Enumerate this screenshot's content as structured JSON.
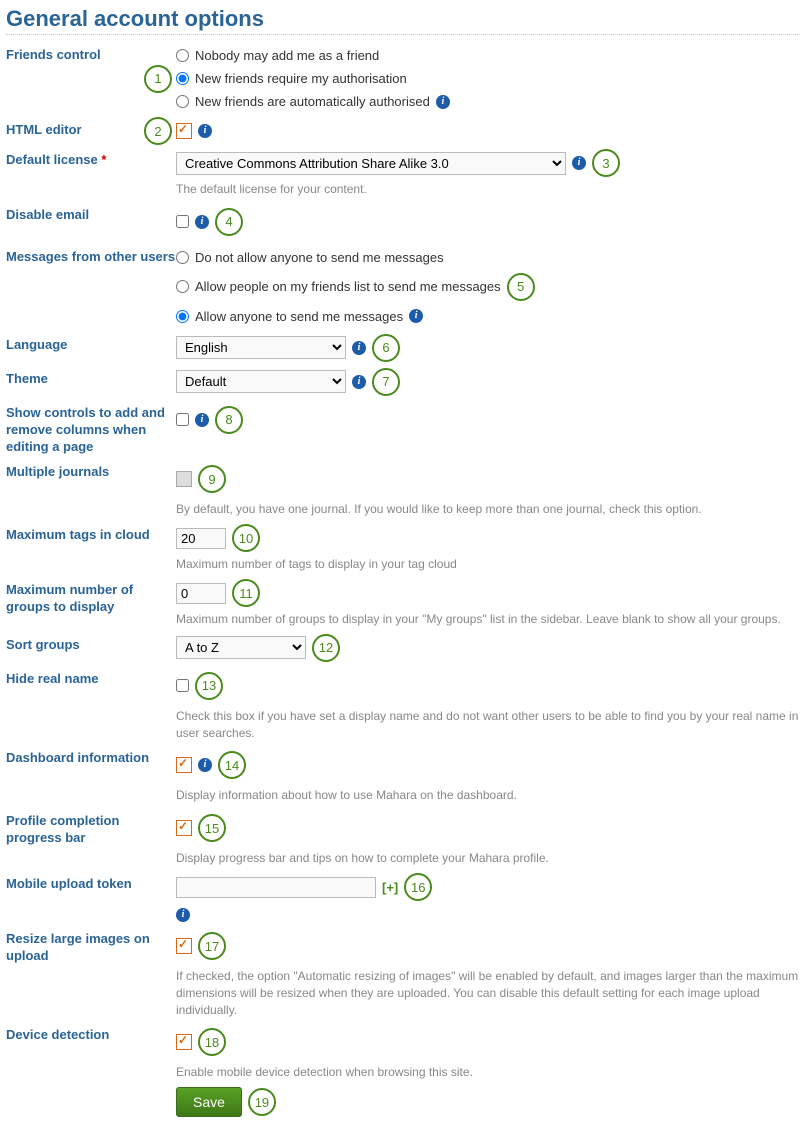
{
  "heading": "General account options",
  "friends": {
    "label": "Friends control",
    "opt_nobody": "Nobody may add me as a friend",
    "opt_auth": "New friends require my authorisation",
    "opt_auto": "New friends are automatically authorised"
  },
  "html_editor": {
    "label": "HTML editor"
  },
  "license": {
    "label": "Default license",
    "value": "Creative Commons Attribution Share Alike 3.0",
    "desc": "The default license for your content."
  },
  "disable_email": {
    "label": "Disable email"
  },
  "messages": {
    "label": "Messages from other users",
    "opt_none": "Do not allow anyone to send me messages",
    "opt_friends": "Allow people on my friends list to send me messages",
    "opt_anyone": "Allow anyone to send me messages"
  },
  "language": {
    "label": "Language",
    "value": "English"
  },
  "theme": {
    "label": "Theme",
    "value": "Default"
  },
  "addremove": {
    "label": "Show controls to add and remove columns when editing a page"
  },
  "journals": {
    "label": "Multiple journals",
    "desc": "By default, you have one journal. If you would like to keep more than one journal, check this option."
  },
  "tags": {
    "label": "Maximum tags in cloud",
    "value": "20",
    "desc": "Maximum number of tags to display in your tag cloud"
  },
  "groups_num": {
    "label": "Maximum number of groups to display",
    "value": "0",
    "desc": "Maximum number of groups to display in your \"My groups\" list in the sidebar. Leave blank to show all your groups."
  },
  "sort": {
    "label": "Sort groups",
    "value": "A to Z"
  },
  "hide_name": {
    "label": "Hide real name",
    "desc": "Check this box if you have set a display name and do not want other users to be able to find you by your real name in user searches."
  },
  "dashboard": {
    "label": "Dashboard information",
    "desc": "Display information about how to use Mahara on the dashboard."
  },
  "progress": {
    "label": "Profile completion progress bar",
    "desc": "Display progress bar and tips on how to complete your Mahara profile."
  },
  "mobile": {
    "label": "Mobile upload token",
    "value": "",
    "plus": "[+]"
  },
  "resize": {
    "label": "Resize large images on upload",
    "desc": "If checked, the option \"Automatic resizing of images\" will be enabled by default, and images larger than the maximum dimensions will be resized when they are uploaded. You can disable this default setting for each image upload individually."
  },
  "device": {
    "label": "Device detection",
    "desc": "Enable mobile device detection when browsing this site."
  },
  "save": "Save",
  "markers": {
    "m1": "1",
    "m2": "2",
    "m3": "3",
    "m4": "4",
    "m5": "5",
    "m6": "6",
    "m7": "7",
    "m8": "8",
    "m9": "9",
    "m10": "10",
    "m11": "11",
    "m12": "12",
    "m13": "13",
    "m14": "14",
    "m15": "15",
    "m16": "16",
    "m17": "17",
    "m18": "18",
    "m19": "19"
  }
}
